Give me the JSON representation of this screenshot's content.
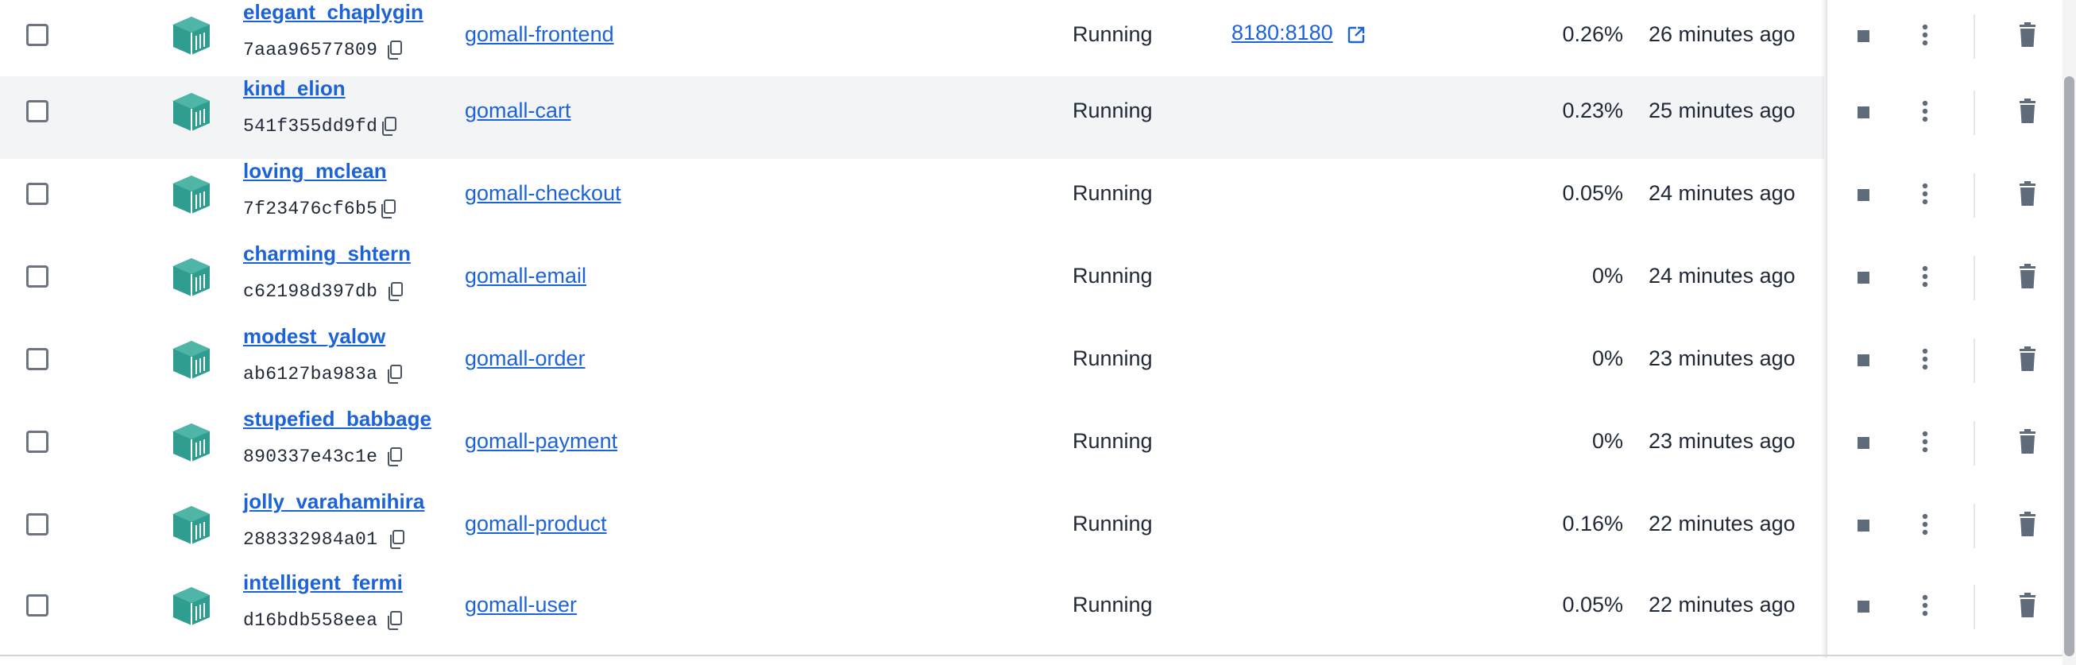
{
  "colors": {
    "link": "#1d63d8",
    "container_icon": "#2f9d8f",
    "hover_row_bg": "#f3f4f6",
    "action_icon": "#5f6a7a"
  },
  "icons": {
    "container": "container-icon",
    "copy": "copy-icon",
    "external": "external-link-icon",
    "stop": "stop-icon",
    "more": "more-vertical-icon",
    "delete": "trash-icon"
  },
  "containers": [
    {
      "name": "elegant_chaplygin",
      "id": "7aaa96577809",
      "image": "gomall-frontend",
      "status": "Running",
      "port": "8180:8180",
      "cpu": "0.26%",
      "last_started": "26 minutes ago"
    },
    {
      "name": "kind_elion",
      "id": "541f355dd9fd",
      "image": "gomall-cart",
      "status": "Running",
      "port": "",
      "cpu": "0.23%",
      "last_started": "25 minutes ago"
    },
    {
      "name": "loving_mclean",
      "id": "7f23476cf6b5",
      "image": "gomall-checkout",
      "status": "Running",
      "port": "",
      "cpu": "0.05%",
      "last_started": "24 minutes ago"
    },
    {
      "name": "charming_shtern",
      "id": "c62198d397db",
      "image": "gomall-email",
      "status": "Running",
      "port": "",
      "cpu": "0%",
      "last_started": "24 minutes ago"
    },
    {
      "name": "modest_yalow",
      "id": "ab6127ba983a",
      "image": "gomall-order",
      "status": "Running",
      "port": "",
      "cpu": "0%",
      "last_started": "23 minutes ago"
    },
    {
      "name": "stupefied_babbage",
      "id": "890337e43c1e",
      "image": "gomall-payment",
      "status": "Running",
      "port": "",
      "cpu": "0%",
      "last_started": "23 minutes ago"
    },
    {
      "name": "jolly_varahamihira",
      "id": "288332984a01",
      "image": "gomall-product",
      "status": "Running",
      "port": "",
      "cpu": "0.16%",
      "last_started": "22 minutes ago"
    },
    {
      "name": "intelligent_fermi",
      "id": "d16bdb558eea",
      "image": "gomall-user",
      "status": "Running",
      "port": "",
      "cpu": "0.05%",
      "last_started": "22 minutes ago"
    }
  ]
}
